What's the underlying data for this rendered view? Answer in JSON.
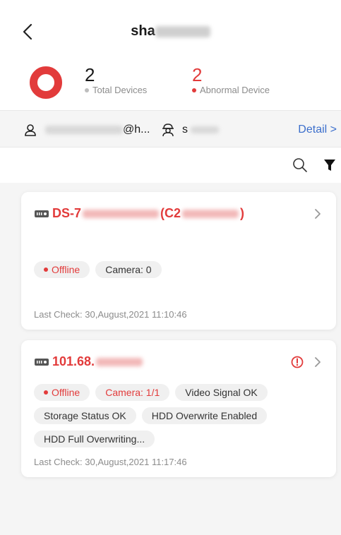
{
  "header": {
    "title_visible": "sha",
    "back_icon": "chevron-left-icon"
  },
  "summary": {
    "total_count": "2",
    "total_label": "Total Devices",
    "abnormal_count": "2",
    "abnormal_label": "Abnormal Device",
    "ring_color": "#e23b3b",
    "total_dot_color": "#bdbdbd",
    "abnormal_dot_color": "#e23b3b"
  },
  "info": {
    "account_suffix": "@h...",
    "installer_prefix": "s",
    "detail_label": "Detail >",
    "account_icon": "user-icon",
    "installer_icon": "installer-icon"
  },
  "toolbar": {
    "search_icon": "search-icon",
    "filter_icon": "filter-icon"
  },
  "devices": [
    {
      "name_prefix": "DS-7",
      "name_mid": "(C2",
      "name_end": ")",
      "tags": [
        {
          "text": "Offline",
          "red": true,
          "dot": true
        },
        {
          "text": "Camera: 0",
          "red": false,
          "dot": false
        }
      ],
      "last_check": "Last Check: 30,August,2021 11:10:46"
    },
    {
      "name_prefix": "101.68.",
      "tags": [
        {
          "text": "Offline",
          "red": true,
          "dot": true
        },
        {
          "text": "Camera: 1/1",
          "red": true,
          "dot": false
        },
        {
          "text": "Video Signal OK",
          "red": false,
          "dot": false
        },
        {
          "text": "Storage Status OK",
          "red": false,
          "dot": false
        },
        {
          "text": "HDD Overwrite Enabled",
          "red": false,
          "dot": false
        },
        {
          "text": "HDD Full Overwriting...",
          "red": false,
          "dot": false
        }
      ],
      "last_check": "Last Check: 30,August,2021 11:17:46"
    }
  ]
}
